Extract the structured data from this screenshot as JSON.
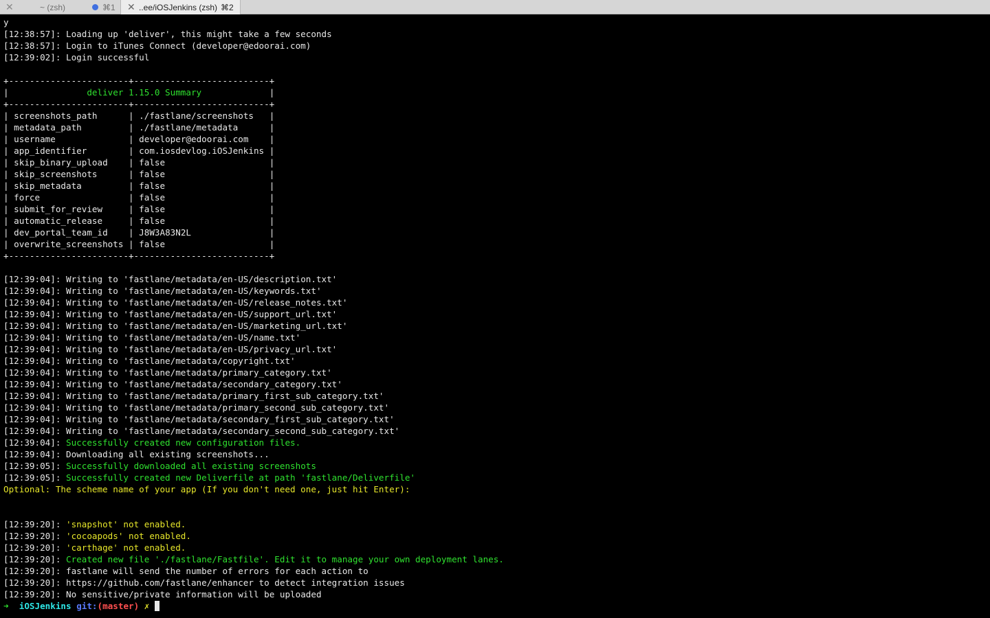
{
  "tabs": [
    {
      "title": "~ (zsh)",
      "shortcut": "⌘1",
      "active": false,
      "has_activity_dot": true
    },
    {
      "title": "..ee/iOSJenkins (zsh)",
      "shortcut": "⌘2",
      "active": true
    }
  ],
  "colors": {
    "accent_green": "#2fe12f",
    "accent_yellow": "#e6e62a",
    "background": "#000000",
    "text": "#e8e8e8"
  },
  "output": {
    "echo": "y",
    "intro": [
      "[12:38:57]: Loading up 'deliver', this might take a few seconds",
      "[12:38:57]: Login to iTunes Connect (developer@edoorai.com)",
      "[12:39:02]: Login successful"
    ],
    "summary_border": "+-----------------------+--------------------------+",
    "summary_title": "deliver 1.15.0 Summary",
    "summary_rows": [
      {
        "key": "screenshots_path",
        "value": "./fastlane/screenshots"
      },
      {
        "key": "metadata_path",
        "value": "./fastlane/metadata"
      },
      {
        "key": "username",
        "value": "developer@edoorai.com"
      },
      {
        "key": "app_identifier",
        "value": "com.iosdevlog.iOSJenkins"
      },
      {
        "key": "skip_binary_upload",
        "value": "false"
      },
      {
        "key": "skip_screenshots",
        "value": "false"
      },
      {
        "key": "skip_metadata",
        "value": "false"
      },
      {
        "key": "force",
        "value": "false"
      },
      {
        "key": "submit_for_review",
        "value": "false"
      },
      {
        "key": "automatic_release",
        "value": "false"
      },
      {
        "key": "dev_portal_team_id",
        "value": "J8W3A83N2L"
      },
      {
        "key": "overwrite_screenshots",
        "value": "false"
      }
    ],
    "log_lines": [
      {
        "ts": "[12:39:04]:",
        "text": "Writing to 'fastlane/metadata/en-US/description.txt'",
        "color": "default"
      },
      {
        "ts": "[12:39:04]:",
        "text": "Writing to 'fastlane/metadata/en-US/keywords.txt'",
        "color": "default"
      },
      {
        "ts": "[12:39:04]:",
        "text": "Writing to 'fastlane/metadata/en-US/release_notes.txt'",
        "color": "default"
      },
      {
        "ts": "[12:39:04]:",
        "text": "Writing to 'fastlane/metadata/en-US/support_url.txt'",
        "color": "default"
      },
      {
        "ts": "[12:39:04]:",
        "text": "Writing to 'fastlane/metadata/en-US/marketing_url.txt'",
        "color": "default"
      },
      {
        "ts": "[12:39:04]:",
        "text": "Writing to 'fastlane/metadata/en-US/name.txt'",
        "color": "default"
      },
      {
        "ts": "[12:39:04]:",
        "text": "Writing to 'fastlane/metadata/en-US/privacy_url.txt'",
        "color": "default"
      },
      {
        "ts": "[12:39:04]:",
        "text": "Writing to 'fastlane/metadata/copyright.txt'",
        "color": "default"
      },
      {
        "ts": "[12:39:04]:",
        "text": "Writing to 'fastlane/metadata/primary_category.txt'",
        "color": "default"
      },
      {
        "ts": "[12:39:04]:",
        "text": "Writing to 'fastlane/metadata/secondary_category.txt'",
        "color": "default"
      },
      {
        "ts": "[12:39:04]:",
        "text": "Writing to 'fastlane/metadata/primary_first_sub_category.txt'",
        "color": "default"
      },
      {
        "ts": "[12:39:04]:",
        "text": "Writing to 'fastlane/metadata/primary_second_sub_category.txt'",
        "color": "default"
      },
      {
        "ts": "[12:39:04]:",
        "text": "Writing to 'fastlane/metadata/secondary_first_sub_category.txt'",
        "color": "default"
      },
      {
        "ts": "[12:39:04]:",
        "text": "Writing to 'fastlane/metadata/secondary_second_sub_category.txt'",
        "color": "default"
      },
      {
        "ts": "[12:39:04]:",
        "text": "Successfully created new configuration files.",
        "color": "green"
      },
      {
        "ts": "[12:39:04]:",
        "text": "Downloading all existing screenshots...",
        "color": "default"
      },
      {
        "ts": "[12:39:05]:",
        "text": "Successfully downloaded all existing screenshots",
        "color": "green"
      },
      {
        "ts": "[12:39:05]:",
        "text": "Successfully created new Deliverfile at path 'fastlane/Deliverfile'",
        "color": "green"
      }
    ],
    "question": "Optional: The scheme name of your app (If you don't need one, just hit Enter):",
    "final_lines": [
      {
        "ts": "[12:39:20]:",
        "text": "'snapshot' not enabled.",
        "color": "yellow"
      },
      {
        "ts": "[12:39:20]:",
        "text": "'cocoapods' not enabled.",
        "color": "yellow"
      },
      {
        "ts": "[12:39:20]:",
        "text": "'carthage' not enabled.",
        "color": "yellow"
      },
      {
        "ts": "[12:39:20]:",
        "text": "Created new file './fastlane/Fastfile'. Edit it to manage your own deployment lanes.",
        "color": "green"
      },
      {
        "ts": "[12:39:20]:",
        "text": "fastlane will send the number of errors for each action to",
        "color": "default"
      },
      {
        "ts": "[12:39:20]:",
        "text": "https://github.com/fastlane/enhancer to detect integration issues",
        "color": "default"
      },
      {
        "ts": "[12:39:20]:",
        "text": "No sensitive/private information will be uploaded",
        "color": "default"
      }
    ],
    "prompt": {
      "arrow": "➜",
      "dir": "iOSJenkins",
      "git_label": "git:",
      "branch": "(master)",
      "dirty": "✗"
    }
  }
}
